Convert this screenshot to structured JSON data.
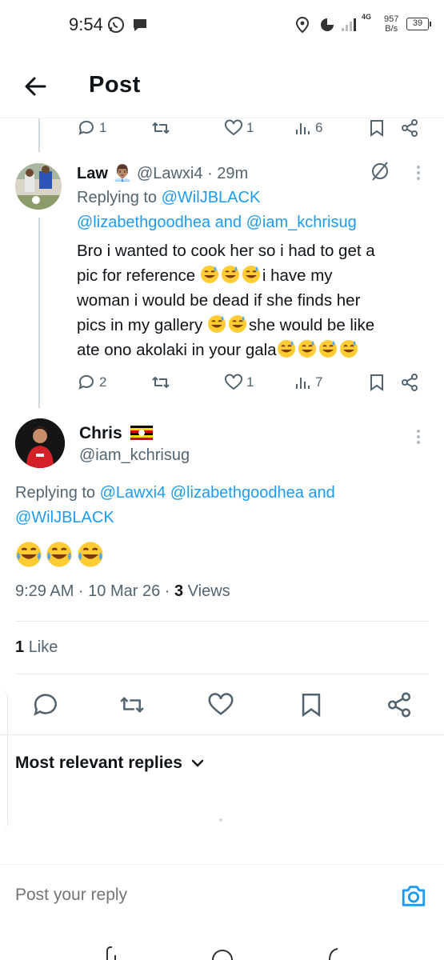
{
  "status_bar": {
    "time": "9:54",
    "network_type": "4G",
    "speed_value": "957",
    "speed_unit": "B/s",
    "battery": "39",
    "icons": [
      "whatsapp-icon",
      "chat-icon",
      "location-icon",
      "data-saver-icon",
      "signal-icon",
      "battery-icon"
    ]
  },
  "header": {
    "title": "Post"
  },
  "prev_tweet_actions": {
    "replies": "1",
    "likes": "1",
    "views": "6"
  },
  "reply_tweet": {
    "name": "Law",
    "name_emoji": "👨🏽‍💼",
    "handle": "@Lawxi4",
    "time": "· 29m",
    "replying_label": "Replying to",
    "replying_to": [
      "@WilJBLACK",
      "@lizabethgoodhea",
      "@iam_kchrisug"
    ],
    "and_label": "and",
    "text_lines": [
      "Bro i wanted to cook her so i had to get a",
      "pic for reference",
      "i have my",
      "woman i would be dead if she finds her",
      "pics in my gallery",
      "she would be like",
      "ate ono akolaki in your gala"
    ],
    "replies": "2",
    "likes": "1",
    "views": "7"
  },
  "main_tweet": {
    "name": "Chris",
    "handle": "@iam_kchrisug",
    "replying_label": "Replying to",
    "replying_to": [
      "@Lawxi4",
      "@lizabethgoodhea",
      "@WilJBLACK"
    ],
    "and_label": "and",
    "timestamp": "9:29 AM · 10 Mar 26 ·",
    "views_count": "3",
    "views_label": "Views",
    "likes_count": "1",
    "likes_label": "Like"
  },
  "sort": {
    "label": "Most relevant replies"
  },
  "reply_bar": {
    "placeholder": "Post your reply"
  },
  "colors": {
    "accent": "#1d9bf0",
    "text_secondary": "#536471",
    "text_primary": "#0f1419",
    "emoji": "#ffcc33"
  }
}
